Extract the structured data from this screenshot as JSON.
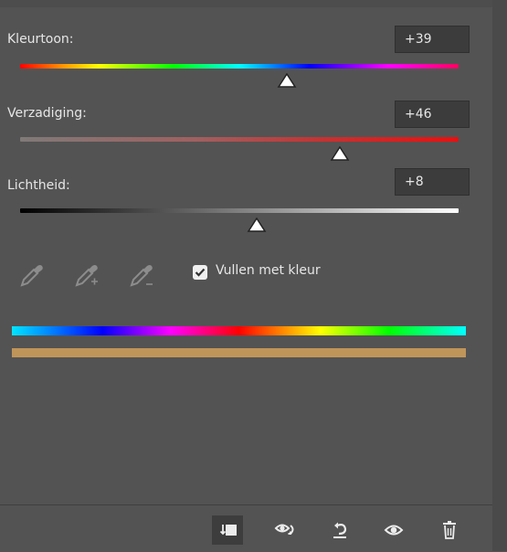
{
  "hue": {
    "label": "Kleurtoon:",
    "value": "+39",
    "level": 39,
    "min": -180,
    "max": 180
  },
  "saturation": {
    "label": "Verzadiging:",
    "value": "+46",
    "level": 46,
    "min": -100,
    "max": 100
  },
  "lightness": {
    "label": "Lichtheid:",
    "value": "+8",
    "level": 8,
    "min": -100,
    "max": 100
  },
  "tools": {
    "eyedropper": "eyedropper-icon",
    "eyedropper_add": "eyedropper-plus-icon",
    "eyedropper_subtract": "eyedropper-minus-icon"
  },
  "colorize": {
    "label": "Vullen met kleur",
    "checked": true
  },
  "colors": {
    "panel_bg": "#535353",
    "result_color": "#c0955a",
    "saturation_track_end": "#e81010"
  },
  "footer": {
    "buttons": [
      {
        "icon": "clip-to-layer-icon",
        "active": true
      },
      {
        "icon": "view-previous-state-icon",
        "active": false
      },
      {
        "icon": "reset-icon",
        "active": false
      },
      {
        "icon": "visibility-eye-icon",
        "active": false
      },
      {
        "icon": "trash-icon",
        "active": false
      }
    ]
  }
}
